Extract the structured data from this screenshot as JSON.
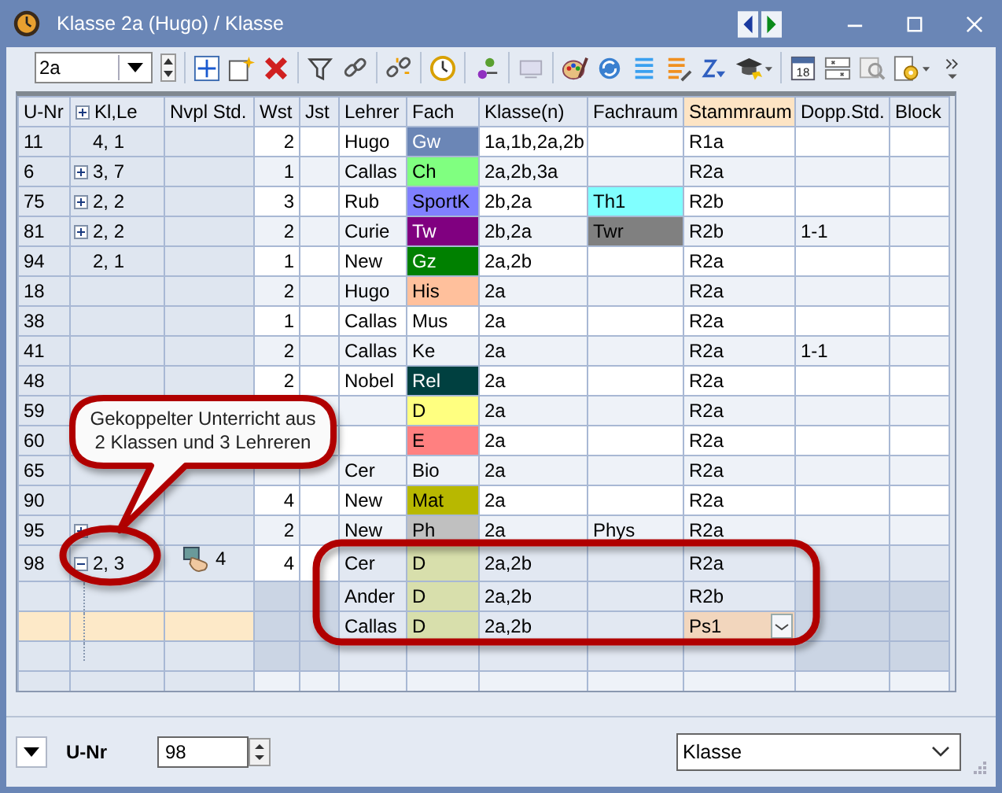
{
  "window": {
    "title": "Klasse 2a (Hugo) / Klasse"
  },
  "toolbar": {
    "class_selector": "2a",
    "calendar_day": "18"
  },
  "table": {
    "columns": [
      {
        "label": "U-Nr",
        "selected": false
      },
      {
        "label": "Kl,Le",
        "selected": false,
        "expander": true
      },
      {
        "label": "Nvpl Std.",
        "selected": false
      },
      {
        "label": "Wst",
        "selected": false
      },
      {
        "label": "Jst",
        "selected": false
      },
      {
        "label": "Lehrer",
        "selected": false
      },
      {
        "label": "Fach",
        "selected": false
      },
      {
        "label": "Klasse(n)",
        "selected": false
      },
      {
        "label": "Fachraum",
        "selected": false
      },
      {
        "label": "Stammraum",
        "selected": true
      },
      {
        "label": "Dopp.Std.",
        "selected": false
      },
      {
        "label": "Block",
        "selected": false
      }
    ],
    "rows": [
      {
        "u_nr": "11",
        "kl_le": "4, 1",
        "wst": "2",
        "lehrer": "Hugo",
        "fach": "Gw",
        "color": "#6b86b6",
        "klasse": "1a,1b,2a,2b",
        "stammraum": "R1a"
      },
      {
        "u_nr": "6",
        "kl_le": "3, 7",
        "expanded": false,
        "wst": "1",
        "lehrer": "Callas",
        "fach": "Ch",
        "color": "#80ff80",
        "klasse": "2a,2b,3a",
        "stammraum": "R2a"
      },
      {
        "u_nr": "75",
        "kl_le": "2, 2",
        "expanded": false,
        "wst": "3",
        "lehrer": "Rub",
        "fach": "SportK",
        "color": "#8080ff",
        "klasse": "2b,2a",
        "fachraum": {
          "label": "Th1",
          "color": "#80ffff"
        },
        "stammraum": "R2b"
      },
      {
        "u_nr": "81",
        "kl_le": "2, 2",
        "expanded": false,
        "wst": "2",
        "lehrer": "Curie",
        "fach": "Tw",
        "color": "#800080",
        "klasse": "2b,2a",
        "fachraum": {
          "label": "Twr",
          "color": "#808080"
        },
        "stammraum": "R2b",
        "dopp": "1-1"
      },
      {
        "u_nr": "94",
        "kl_le": "2, 1",
        "wst": "1",
        "lehrer": "New",
        "fach": "Gz",
        "color": "#008000",
        "klasse": "2a,2b",
        "stammraum": "R2a"
      },
      {
        "u_nr": "18",
        "wst": "2",
        "lehrer": "Hugo",
        "fach": "His",
        "color": "#ffc09c",
        "klasse": "2a",
        "stammraum": "R2a"
      },
      {
        "u_nr": "38",
        "wst": "1",
        "lehrer": "Callas",
        "fach": "Mus",
        "klasse": "2a",
        "stammraum": "R2a"
      },
      {
        "u_nr": "41",
        "wst": "2",
        "lehrer": "Callas",
        "fach": "Ke",
        "klasse": "2a",
        "stammraum": "R2a",
        "dopp": "1-1"
      },
      {
        "u_nr": "48",
        "wst": "2",
        "lehrer": "Nobel",
        "fach": "Rel",
        "color": "#004040",
        "klasse": "2a",
        "stammraum": "R2a"
      },
      {
        "u_nr": "59",
        "fach": "D",
        "color": "#ffff80",
        "klasse": "2a",
        "stammraum": "R2a"
      },
      {
        "u_nr": "60",
        "fach": "E",
        "color": "#ff8080",
        "klasse": "2a",
        "stammraum": "R2a"
      },
      {
        "u_nr": "65",
        "lehrer": "Cer",
        "fach": "Bio",
        "klasse": "2a",
        "stammraum": "R2a"
      },
      {
        "u_nr": "90",
        "wst": "4",
        "lehrer": "New",
        "fach": "Mat",
        "color": "#b8b800",
        "klasse": "2a",
        "stammraum": "R2a"
      },
      {
        "u_nr": "95",
        "expanded": false,
        "wst": "2",
        "lehrer": "New",
        "fach": "Ph",
        "color": "#c0c0c0",
        "klasse": "2a",
        "fachraum": {
          "label": "Phys"
        },
        "stammraum": "R2a"
      },
      {
        "u_nr": "98",
        "kl_le": "2, 3",
        "expanded": true,
        "nvpl": "4",
        "wst": "4",
        "lehrer": "Cer",
        "fach": "D",
        "color": "#d8dfac",
        "klasse": "2a,2b",
        "stammraum": "R2a",
        "children": [
          {
            "lehrer": "Ander",
            "fach": "D",
            "color": "#d8dfac",
            "klasse": "2a,2b",
            "stammraum": "R2b",
            "selected": false
          },
          {
            "lehrer": "Callas",
            "fach": "D",
            "color": "#d8dfac",
            "klasse": "2a,2b",
            "stammraum": "Ps1",
            "selected": true
          }
        ]
      }
    ]
  },
  "callout": {
    "text": "Gekoppelter Unterricht aus 2 Klassen und 3 Lehreren"
  },
  "footer": {
    "sort_label": "U-Nr",
    "number_value": "98",
    "view_select": "Klasse"
  }
}
